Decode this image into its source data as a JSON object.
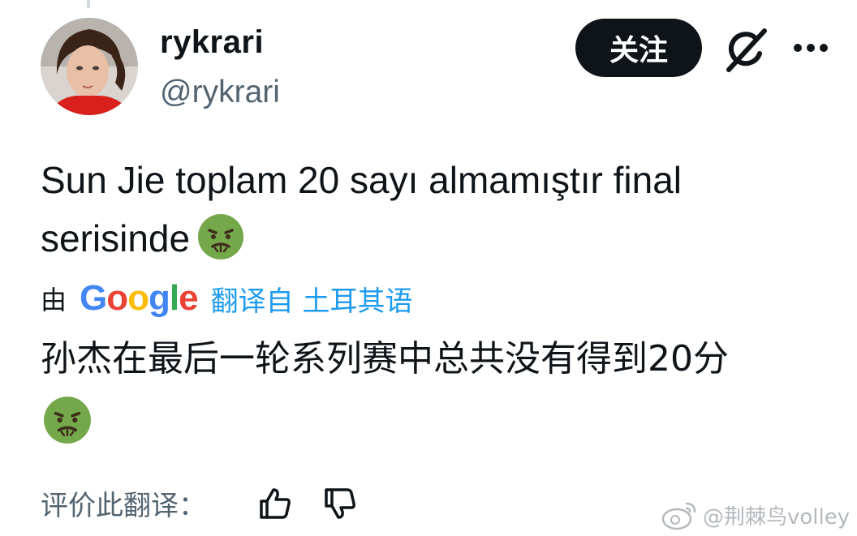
{
  "user": {
    "display_name": "rykrari",
    "handle": "@rykrari"
  },
  "actions": {
    "follow_label": "关注",
    "grok_icon": "grok-icon",
    "more_icon": "more-icon"
  },
  "tweet": {
    "text": "Sun Jie toplam 20 sayı almamıştır final serisinde",
    "emoji": "nauseated-face-emoji"
  },
  "translation": {
    "by_label": "由",
    "provider": [
      "G",
      "o",
      "o",
      "g",
      "l",
      "e"
    ],
    "source_language": "翻译自 土耳其语",
    "text": "孙杰在最后一轮系列赛中总共没有得到20分",
    "emoji": "nauseated-face-emoji"
  },
  "rating": {
    "label": "评价此翻译：",
    "thumbs_up_icon": "thumbs-up-icon",
    "thumbs_down_icon": "thumbs-down-icon"
  },
  "watermark": {
    "text": "@荆棘鸟volley",
    "logo": "weibo-logo"
  },
  "colors": {
    "link": "#1d9bf0",
    "secondary_text": "#536471",
    "follow_button": "#0f1419",
    "google_blue": "#4285F4",
    "google_red": "#EA4335",
    "google_yellow": "#FBBC05",
    "google_green": "#34A853",
    "emoji_green": "#74a84b"
  }
}
